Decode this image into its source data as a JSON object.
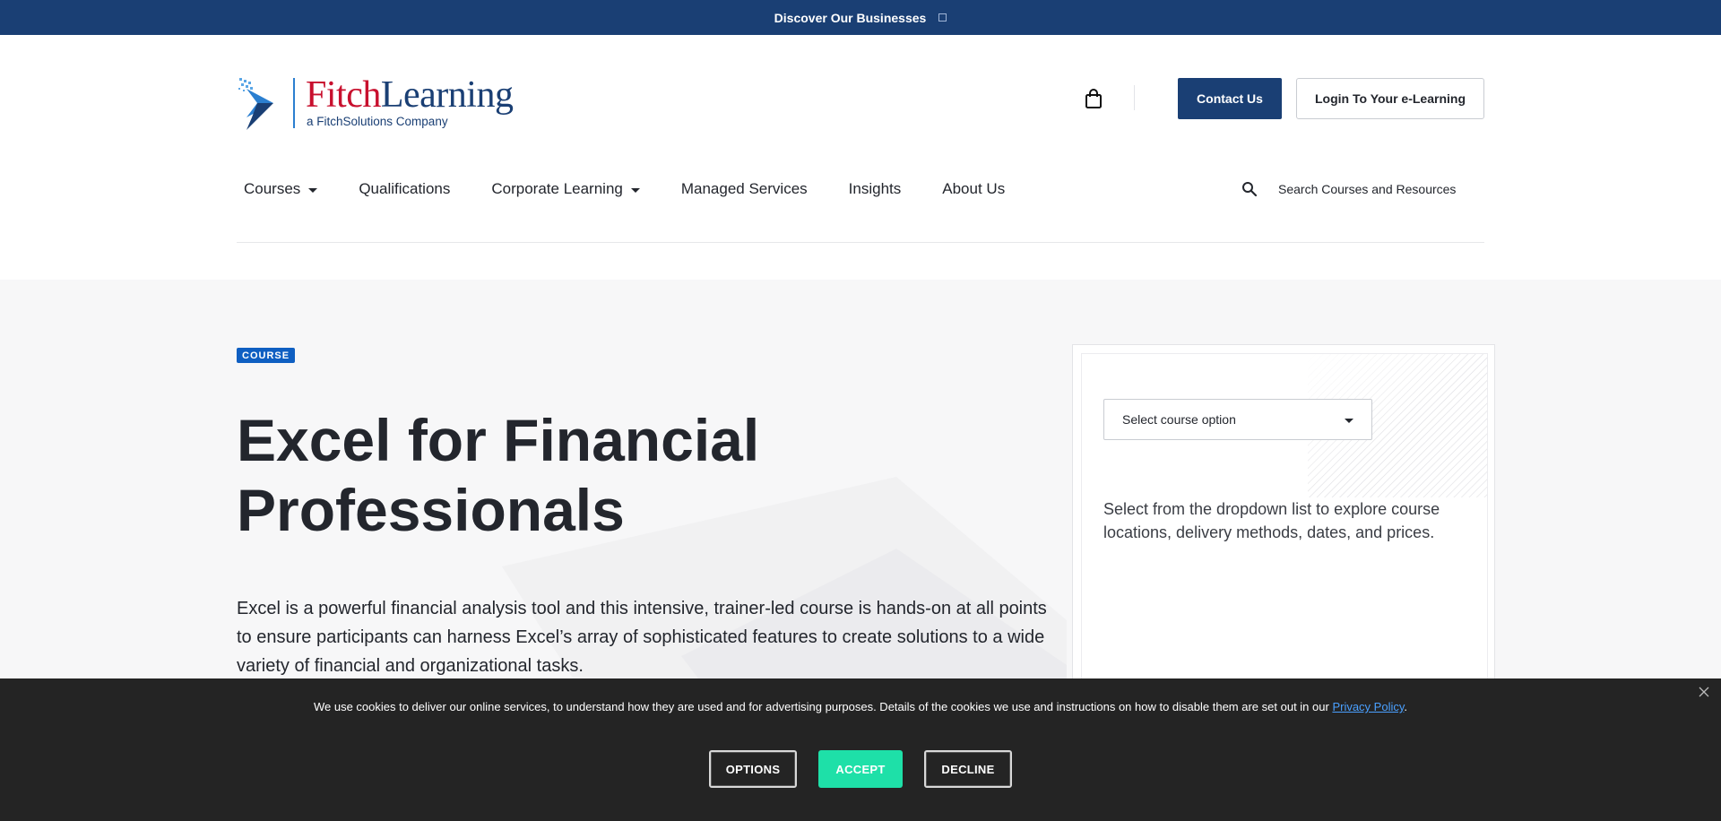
{
  "topbar": {
    "label": "Discover Our Businesses",
    "icon": "external-link-icon"
  },
  "brand": {
    "name_part1": "Fitch",
    "name_part2": "Learning",
    "tagline": "a FitchSolutions Company",
    "colors": {
      "red": "#c8102e",
      "navy": "#1a3f74",
      "accent_blue": "#2b7fd0"
    }
  },
  "header": {
    "cart_icon": "shopping-bag-icon",
    "contact_label": "Contact Us",
    "login_label": "Login To Your e-Learning"
  },
  "nav": {
    "items": [
      {
        "label": "Courses",
        "has_dropdown": true
      },
      {
        "label": "Qualifications",
        "has_dropdown": false
      },
      {
        "label": "Corporate Learning",
        "has_dropdown": true
      },
      {
        "label": "Managed Services",
        "has_dropdown": false
      },
      {
        "label": "Insights",
        "has_dropdown": false
      },
      {
        "label": "About Us",
        "has_dropdown": false
      }
    ],
    "search_placeholder": "Search Courses and Resources",
    "search_icon": "search-icon"
  },
  "hero": {
    "badge": "COURSE",
    "title": "Excel for Financial Professionals",
    "description": "Excel is a powerful financial analysis tool and this intensive, trainer-led course is hands-on at all points to ensure participants can harness Excel’s array of sophisticated features to create solutions to a wide variety of financial and organizational tasks."
  },
  "course_panel": {
    "select_value": "Select course option",
    "help_text": "Select from the dropdown list to explore course locations, delivery methods, dates, and prices."
  },
  "cookie": {
    "text": "We use cookies to deliver our online services, to understand how they are used and for advertising purposes. Details of the cookies we use and instructions on how to disable them are set out in our",
    "link_text": "Privacy Policy",
    "text_end": ".",
    "options_label": "OPTIONS",
    "accept_label": "ACCEPT",
    "decline_label": "DECLINE",
    "accept_color": "#1ee0a8"
  }
}
